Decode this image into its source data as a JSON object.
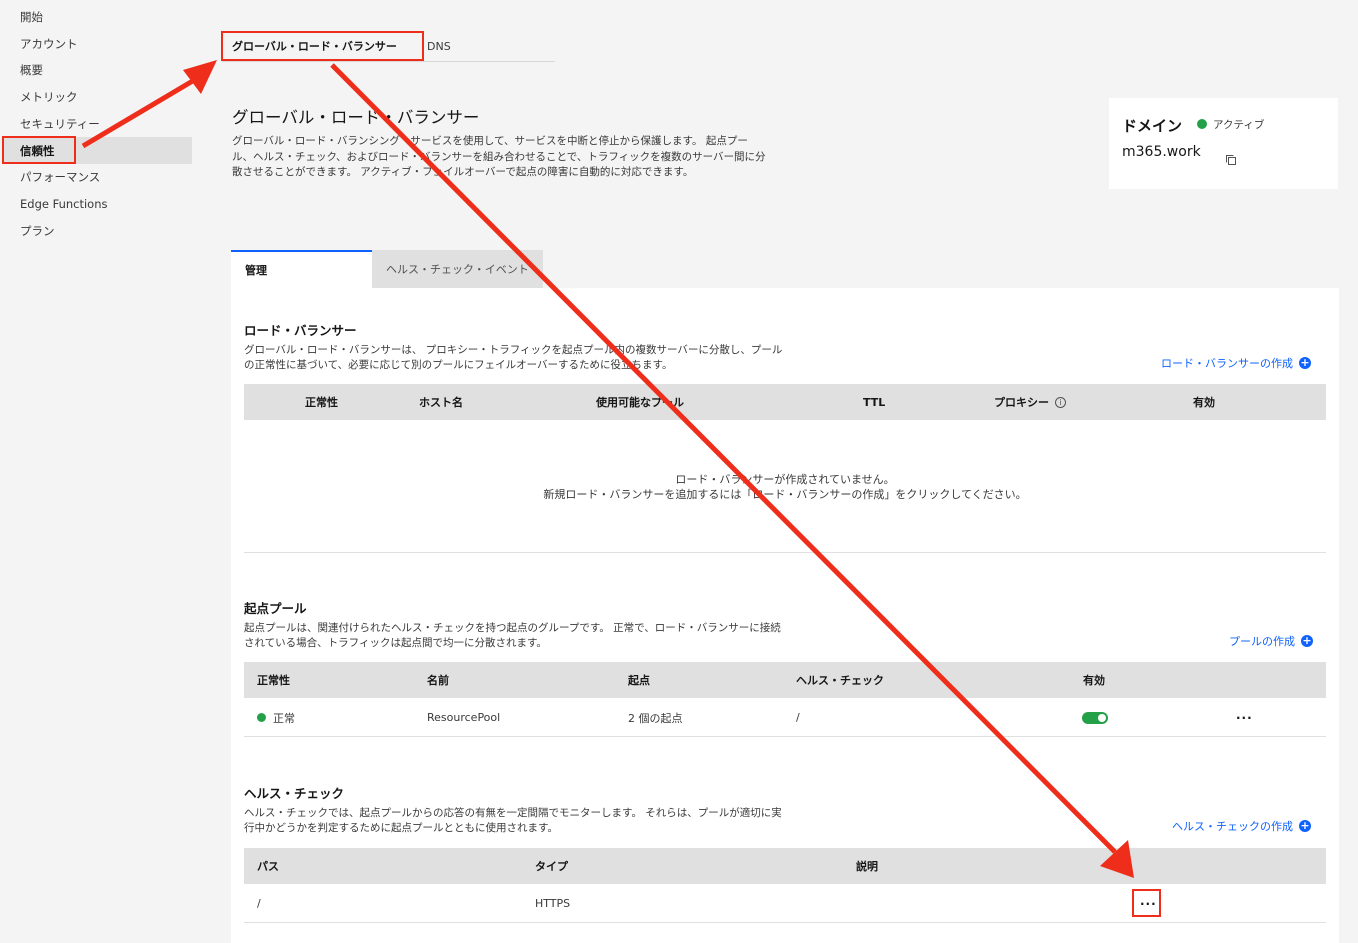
{
  "colors": {
    "accent": "#0f62fe",
    "success": "#24a148",
    "annotation": "#ee2e1b"
  },
  "sidebar": {
    "items": [
      {
        "label": "開始"
      },
      {
        "label": "アカウント"
      },
      {
        "label": "概要"
      },
      {
        "label": "メトリック"
      },
      {
        "label": "セキュリティー"
      },
      {
        "label": "信頼性",
        "active": true
      },
      {
        "label": "パフォーマンス"
      },
      {
        "label": "Edge Functions"
      },
      {
        "label": "プラン"
      }
    ]
  },
  "top_tabs": [
    {
      "label": "グローバル・ロード・バランサー",
      "active": true
    },
    {
      "label": "DNS"
    }
  ],
  "header": {
    "title": "グローバル・ロード・バランサー",
    "description": "グローバル・ロード・バランシング・サービスを使用して、サービスを中断と停止から保護します。 起点プール、ヘルス・チェック、およびロード・バランサーを組み合わせることで、トラフィックを複数のサーバー間に分散させることができます。 アクティブ・フェイルオーバーで起点の障害に自動的に対応できます。"
  },
  "domain_card": {
    "label": "ドメイン",
    "status": "アクティブ",
    "name": "m365.work",
    "copy_icon": "copy-icon"
  },
  "content_tabs": [
    {
      "label": "管理",
      "active": true
    },
    {
      "label": "ヘルス・チェック・イベント"
    }
  ],
  "load_balancers": {
    "title": "ロード・バランサー",
    "description": "グローバル・ロード・バランサーは、 プロキシー・トラフィックを起点プール内の複数サーバーに分散し、プールの正常性に基づいて、必要に応じて別のプールにフェイルオーバーするために役立ちます。",
    "create_label": "ロード・バランサーの作成",
    "columns": [
      "正常性",
      "ホスト名",
      "使用可能なプール",
      "TTL",
      "プロキシー",
      "有効"
    ],
    "empty_line1": "ロード・バランサーが作成されていません。",
    "empty_line2": "新規ロード・バランサーを追加するには「ロード・バランサーの作成」をクリックしてください。"
  },
  "origin_pools": {
    "title": "起点プール",
    "description": "起点プールは、関連付けられたヘルス・チェックを持つ起点のグループです。 正常で、ロード・バランサーに接続されている場合、トラフィックは起点間で均一に分散されます。",
    "create_label": "プールの作成",
    "columns": [
      "正常性",
      "名前",
      "起点",
      "ヘルス・チェック",
      "有効"
    ],
    "rows": [
      {
        "health": "正常",
        "name": "ResourcePool",
        "origins": "2 個の起点",
        "health_check": "/",
        "enabled": true,
        "actions": "···"
      }
    ]
  },
  "health_checks": {
    "title": "ヘルス・チェック",
    "description": "ヘルス・チェックでは、起点プールからの応答の有無を一定間隔でモニターします。 それらは、プールが適切に実行中かどうかを判定するために起点プールとともに使用されます。",
    "create_label": "ヘルス・チェックの作成",
    "columns": [
      "パス",
      "タイプ",
      "説明"
    ],
    "rows": [
      {
        "path": "/",
        "type": "HTTPS",
        "description": "",
        "actions": "···"
      }
    ]
  }
}
